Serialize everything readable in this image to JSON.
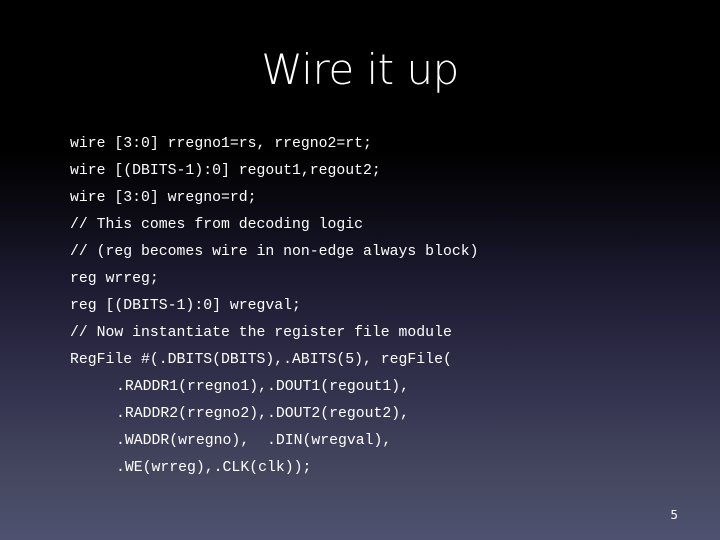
{
  "slide": {
    "title": "Wire it up",
    "page_number": "5",
    "code_lines": [
      {
        "text": "wire [3:0] rregno1=rs, rregno2=rt;",
        "indent": false
      },
      {
        "text": "wire [(DBITS-1):0] regout1,regout2;",
        "indent": false
      },
      {
        "text": "wire [3:0] wregno=rd;",
        "indent": false
      },
      {
        "text": "// This comes from decoding logic",
        "indent": false
      },
      {
        "text": "// (reg becomes wire in non-edge always block)",
        "indent": false
      },
      {
        "text": "reg wrreg;",
        "indent": false
      },
      {
        "text": "reg [(DBITS-1):0] wregval;",
        "indent": false
      },
      {
        "text": "// Now instantiate the register file module",
        "indent": false
      },
      {
        "text": "RegFile #(.DBITS(DBITS),.ABITS(5), regFile(",
        "indent": false
      },
      {
        "text": ".RADDR1(rregno1),.DOUT1(regout1),",
        "indent": true
      },
      {
        "text": ".RADDR2(rregno2),.DOUT2(regout2),",
        "indent": true
      },
      {
        "text": ".WADDR(wregno),  .DIN(wregval),",
        "indent": true
      },
      {
        "text": ".WE(wrreg),.CLK(clk));",
        "indent": true
      }
    ]
  },
  "colors": {
    "background_top": "#000000",
    "background_bottom": "#4e5270",
    "text": "#ffffff"
  }
}
